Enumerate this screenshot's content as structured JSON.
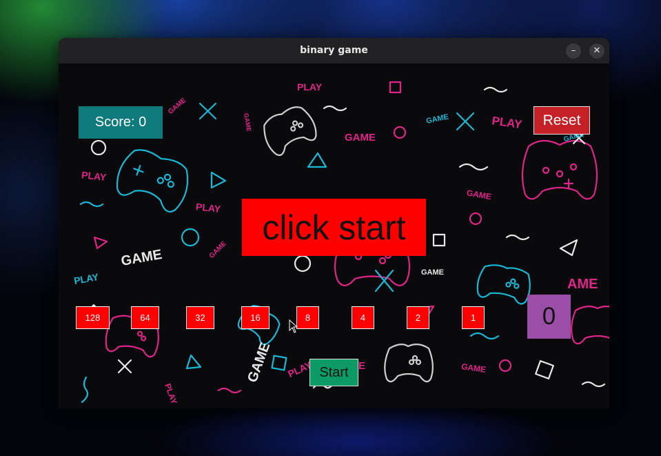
{
  "window": {
    "title": "binary game",
    "minimize_icon": "minimize-icon",
    "close_icon": "close-icon"
  },
  "game": {
    "score_label": "Score: 0",
    "reset_label": "Reset",
    "prompt_text": "click start",
    "bits": [
      "128",
      "64",
      "32",
      "16",
      "8",
      "4",
      "2",
      "1"
    ],
    "result_value": "0",
    "start_label": "Start"
  },
  "background_words": {
    "play": "PLAY",
    "game": "GAME"
  },
  "colors": {
    "score_bg": "#0f7a7b",
    "reset_bg": "#c52026",
    "prompt_bg": "#ff0000",
    "bit_bg": "#ff0000",
    "result_bg": "#9b4ea8",
    "start_bg": "#0c9b65",
    "doodle_pink": "#e0248a",
    "doodle_cyan": "#18b8d8",
    "doodle_white": "#e8e8e8"
  }
}
